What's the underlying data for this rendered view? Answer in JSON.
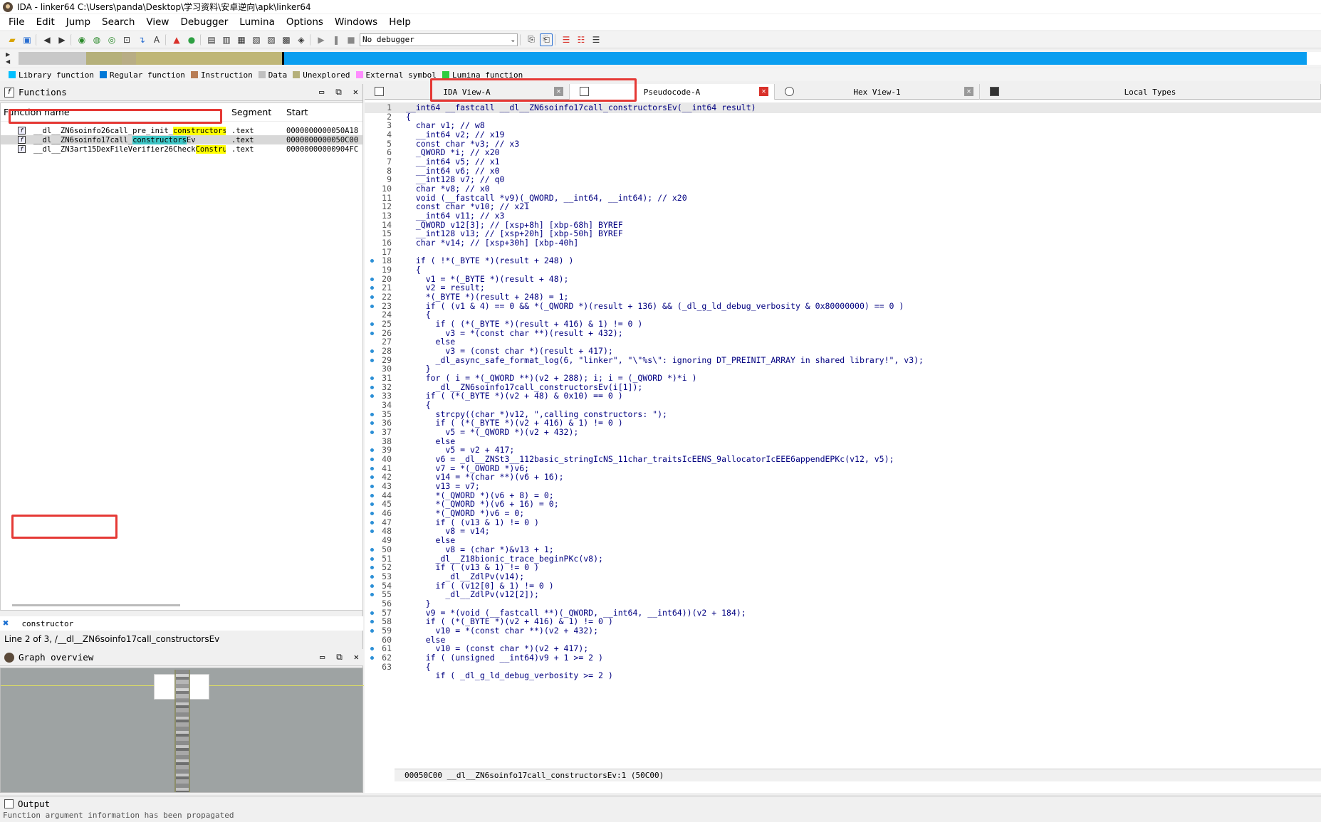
{
  "window": {
    "title": "IDA - linker64 C:\\Users\\panda\\Desktop\\学习资料\\安卓逆向\\apk\\linker64"
  },
  "menu": [
    "File",
    "Edit",
    "Jump",
    "Search",
    "View",
    "Debugger",
    "Lumina",
    "Options",
    "Windows",
    "Help"
  ],
  "toolbar": {
    "debugger_select": "No debugger"
  },
  "legend": [
    {
      "label": "Library function",
      "color": "#00bfff"
    },
    {
      "label": "Regular function",
      "color": "#0078d7"
    },
    {
      "label": "Instruction",
      "color": "#b87d55"
    },
    {
      "label": "Data",
      "color": "#c0c0c0"
    },
    {
      "label": "Unexplored",
      "color": "#b5b07a"
    },
    {
      "label": "External symbol",
      "color": "#ff8cff"
    },
    {
      "label": "Lumina function",
      "color": "#2ecc40"
    }
  ],
  "functions": {
    "title": "Functions",
    "headers": {
      "name": "Function name",
      "segment": "Segment",
      "start": "Start"
    },
    "rows": [
      {
        "pre": "__dl__ZN6soinfo26call_pre_init_",
        "match": "constructors",
        "post": "Ev",
        "segment": ".text",
        "start": "0000000000050A18"
      },
      {
        "pre": "__dl__ZN6soinfo17call_",
        "match": "constructors",
        "post": "Ev",
        "segment": ".text",
        "start": "0000000000050C00"
      },
      {
        "pre": "__dl__ZN3art15DexFileVerifier26Check",
        "match": "Constru",
        "post": "···",
        "segment": ".text",
        "start": "00000000000904FC"
      }
    ],
    "filter": "constructor",
    "status": "Line 2 of 3, /__dl__ZN6soinfo17call_constructorsEv"
  },
  "graph": {
    "title": "Graph overview"
  },
  "tabs": [
    {
      "label": "IDA View-A"
    },
    {
      "label": "Pseudocode-A"
    },
    {
      "label": "Hex View-1"
    },
    {
      "label": "Local Types"
    }
  ],
  "code_status": "00050C00 __dl__ZN6soinfo17call_constructorsEv:1 (50C00)",
  "output": {
    "title": "Output",
    "text": "Function argument information has been propagated"
  },
  "code": [
    {
      "n": "1",
      "d": false,
      "t": "__int64 __fastcall __dl__ZN6soinfo17call_constructorsEv(__int64 result)"
    },
    {
      "n": "2",
      "d": false,
      "t": "{"
    },
    {
      "n": "3",
      "d": false,
      "t": "  char v1; // w8"
    },
    {
      "n": "4",
      "d": false,
      "t": "  __int64 v2; // x19"
    },
    {
      "n": "5",
      "d": false,
      "t": "  const char *v3; // x3"
    },
    {
      "n": "6",
      "d": false,
      "t": "  _QWORD *i; // x20"
    },
    {
      "n": "7",
      "d": false,
      "t": "  __int64 v5; // x1"
    },
    {
      "n": "8",
      "d": false,
      "t": "  __int64 v6; // x0"
    },
    {
      "n": "9",
      "d": false,
      "t": "  __int128 v7; // q0"
    },
    {
      "n": "10",
      "d": false,
      "t": "  char *v8; // x0"
    },
    {
      "n": "11",
      "d": false,
      "t": "  void (__fastcall *v9)(_QWORD, __int64, __int64); // x20"
    },
    {
      "n": "12",
      "d": false,
      "t": "  const char *v10; // x21"
    },
    {
      "n": "13",
      "d": false,
      "t": "  __int64 v11; // x3"
    },
    {
      "n": "14",
      "d": false,
      "t": "  _QWORD v12[3]; // [xsp+8h] [xbp-68h] BYREF"
    },
    {
      "n": "15",
      "d": false,
      "t": "  __int128 v13; // [xsp+20h] [xbp-50h] BYREF"
    },
    {
      "n": "16",
      "d": false,
      "t": "  char *v14; // [xsp+30h] [xbp-40h]"
    },
    {
      "n": "17",
      "d": false,
      "t": ""
    },
    {
      "n": "18",
      "d": true,
      "t": "  if ( !*(_BYTE *)(result + 248) )"
    },
    {
      "n": "19",
      "d": false,
      "t": "  {"
    },
    {
      "n": "20",
      "d": true,
      "t": "    v1 = *(_BYTE *)(result + 48);"
    },
    {
      "n": "21",
      "d": true,
      "t": "    v2 = result;"
    },
    {
      "n": "22",
      "d": true,
      "t": "    *(_BYTE *)(result + 248) = 1;"
    },
    {
      "n": "23",
      "d": true,
      "t": "    if ( (v1 & 4) == 0 && *(_QWORD *)(result + 136) && (_dl_g_ld_debug_verbosity & 0x80000000) == 0 )"
    },
    {
      "n": "24",
      "d": false,
      "t": "    {"
    },
    {
      "n": "25",
      "d": true,
      "t": "      if ( (*(_BYTE *)(result + 416) & 1) != 0 )"
    },
    {
      "n": "26",
      "d": true,
      "t": "        v3 = *(const char **)(result + 432);"
    },
    {
      "n": "27",
      "d": false,
      "t": "      else"
    },
    {
      "n": "28",
      "d": true,
      "t": "        v3 = (const char *)(result + 417);"
    },
    {
      "n": "29",
      "d": true,
      "t": "      _dl_async_safe_format_log(6, \"linker\", \"\\\"%s\\\": ignoring DT_PREINIT_ARRAY in shared library!\", v3);"
    },
    {
      "n": "30",
      "d": false,
      "t": "    }"
    },
    {
      "n": "31",
      "d": true,
      "t": "    for ( i = *(_QWORD **)(v2 + 288); i; i = (_QWORD *)*i )"
    },
    {
      "n": "32",
      "d": true,
      "t": "      _dl__ZN6soinfo17call_constructorsEv(i[1]);"
    },
    {
      "n": "33",
      "d": true,
      "t": "    if ( (*(_BYTE *)(v2 + 48) & 0x10) == 0 )"
    },
    {
      "n": "34",
      "d": false,
      "t": "    {"
    },
    {
      "n": "35",
      "d": true,
      "t": "      strcpy((char *)v12, \",calling constructors: \");"
    },
    {
      "n": "36",
      "d": true,
      "t": "      if ( (*(_BYTE *)(v2 + 416) & 1) != 0 )"
    },
    {
      "n": "37",
      "d": true,
      "t": "        v5 = *(_QWORD *)(v2 + 432);"
    },
    {
      "n": "38",
      "d": false,
      "t": "      else"
    },
    {
      "n": "39",
      "d": true,
      "t": "        v5 = v2 + 417;"
    },
    {
      "n": "40",
      "d": true,
      "t": "      v6 = _dl__ZNSt3__112basic_stringIcNS_11char_traitsIcEENS_9allocatorIcEEE6appendEPKc(v12, v5);"
    },
    {
      "n": "41",
      "d": true,
      "t": "      v7 = *(_OWORD *)v6;"
    },
    {
      "n": "42",
      "d": true,
      "t": "      v14 = *(char **)(v6 + 16);"
    },
    {
      "n": "43",
      "d": true,
      "t": "      v13 = v7;"
    },
    {
      "n": "44",
      "d": true,
      "t": "      *(_QWORD *)(v6 + 8) = 0;"
    },
    {
      "n": "45",
      "d": true,
      "t": "      *(_QWORD *)(v6 + 16) = 0;"
    },
    {
      "n": "46",
      "d": true,
      "t": "      *(_QWORD *)v6 = 0;"
    },
    {
      "n": "47",
      "d": true,
      "t": "      if ( (v13 & 1) != 0 )"
    },
    {
      "n": "48",
      "d": true,
      "t": "        v8 = v14;"
    },
    {
      "n": "49",
      "d": false,
      "t": "      else"
    },
    {
      "n": "50",
      "d": true,
      "t": "        v8 = (char *)&v13 + 1;"
    },
    {
      "n": "51",
      "d": true,
      "t": "      _dl__Z18bionic_trace_beginPKc(v8);"
    },
    {
      "n": "52",
      "d": true,
      "t": "      if ( (v13 & 1) != 0 )"
    },
    {
      "n": "53",
      "d": true,
      "t": "        _dl__ZdlPv(v14);"
    },
    {
      "n": "54",
      "d": true,
      "t": "      if ( (v12[0] & 1) != 0 )"
    },
    {
      "n": "55",
      "d": true,
      "t": "        _dl__ZdlPv(v12[2]);"
    },
    {
      "n": "56",
      "d": false,
      "t": "    }"
    },
    {
      "n": "57",
      "d": true,
      "t": "    v9 = *(void (__fastcall **)(_QWORD, __int64, __int64))(v2 + 184);"
    },
    {
      "n": "58",
      "d": true,
      "t": "    if ( (*(_BYTE *)(v2 + 416) & 1) != 0 )"
    },
    {
      "n": "59",
      "d": true,
      "t": "      v10 = *(const char **)(v2 + 432);"
    },
    {
      "n": "60",
      "d": false,
      "t": "    else"
    },
    {
      "n": "61",
      "d": true,
      "t": "      v10 = (const char *)(v2 + 417);"
    },
    {
      "n": "62",
      "d": true,
      "t": "    if ( (unsigned __int64)v9 + 1 >= 2 )"
    },
    {
      "n": "63",
      "d": false,
      "t": "    {"
    },
    {
      "n": "",
      "d": false,
      "t": "      if ( _dl_g_ld_debug_verbosity >= 2 )"
    }
  ]
}
